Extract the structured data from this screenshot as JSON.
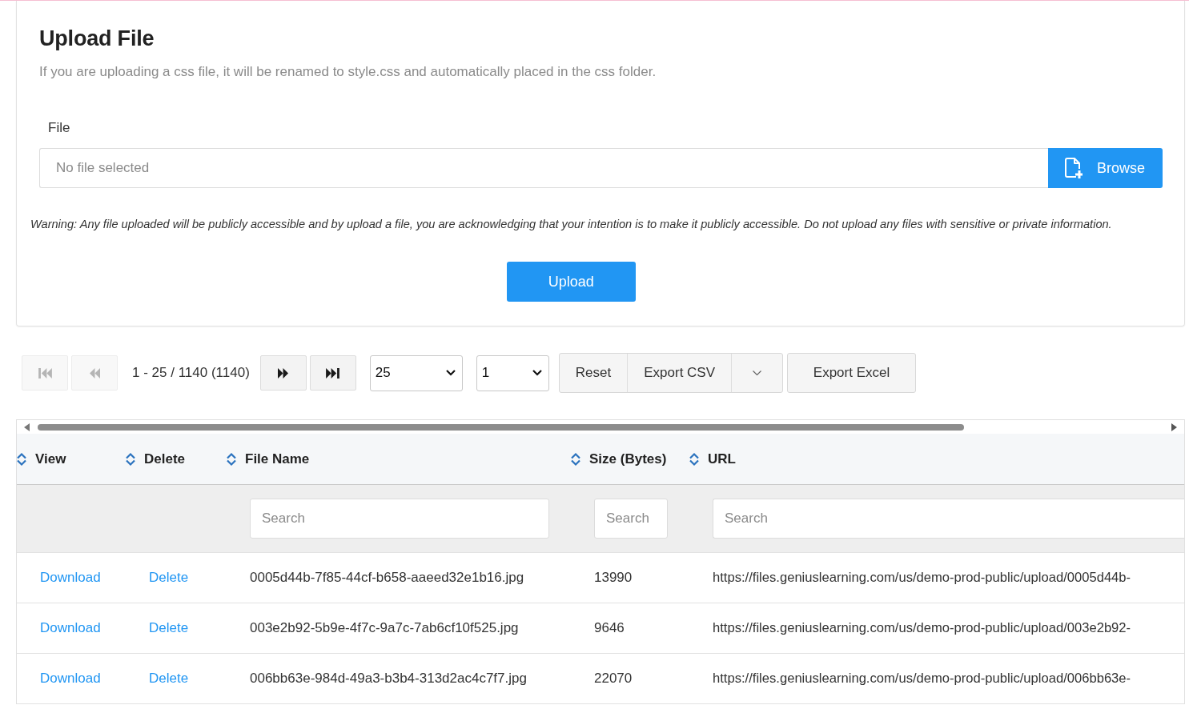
{
  "upload_card": {
    "title": "Upload File",
    "description": "If you are uploading a css file, it will be renamed to style.css and automatically placed in the css folder.",
    "file_field": {
      "label": "File",
      "placeholder": "No file selected",
      "browse_button": "Browse"
    },
    "warning": "Warning: Any file uploaded will be publicly accessible and by upload a file, you are acknowledging that your intention is to make it publicly accessible. Do not upload any files with sensitive or private information.",
    "upload_button": "Upload"
  },
  "toolbar": {
    "pager": {
      "buttons_before": [
        {
          "kind": "first",
          "disabled": true
        },
        {
          "kind": "previous",
          "disabled": true
        }
      ],
      "range": "1 - 25 / 1140 (1140)",
      "buttons_after": [
        {
          "kind": "next",
          "disabled": false
        },
        {
          "kind": "last",
          "disabled": false
        }
      ]
    },
    "page_size_select": {
      "value": "25"
    },
    "page_select": {
      "value": "1"
    },
    "button_group": [
      {
        "kind": "label",
        "label": "Reset"
      },
      {
        "kind": "label",
        "label": "Export CSV"
      },
      {
        "kind": "menu"
      }
    ],
    "export_excel_button": "Export Excel"
  },
  "table": {
    "columns": [
      {
        "label": "View"
      },
      {
        "label": "Delete"
      },
      {
        "label": "File Name",
        "filter_placeholder": "Search"
      },
      {
        "label": "Size (Bytes)",
        "filter_placeholder": "Search"
      },
      {
        "label": "URL",
        "filter_placeholder": "Search"
      }
    ],
    "rows": [
      {
        "view": "Download",
        "delete": "Delete",
        "file_name": "0005d44b-7f85-44cf-b658-aaeed32e1b16.jpg",
        "size": "13990",
        "url": "https://files.geniuslearning.com/us/demo-prod-public/upload/0005d44b-"
      },
      {
        "view": "Download",
        "delete": "Delete",
        "file_name": "003e2b92-5b9e-4f7c-9a7c-7ab6cf10f525.jpg",
        "size": "9646",
        "url": "https://files.geniuslearning.com/us/demo-prod-public/upload/003e2b92-"
      },
      {
        "view": "Download",
        "delete": "Delete",
        "file_name": "006bb63e-984d-49a3-b3b4-313d2ac4c7f7.jpg",
        "size": "22070",
        "url": "https://files.geniuslearning.com/us/demo-prod-public/upload/006bb63e-"
      }
    ]
  }
}
